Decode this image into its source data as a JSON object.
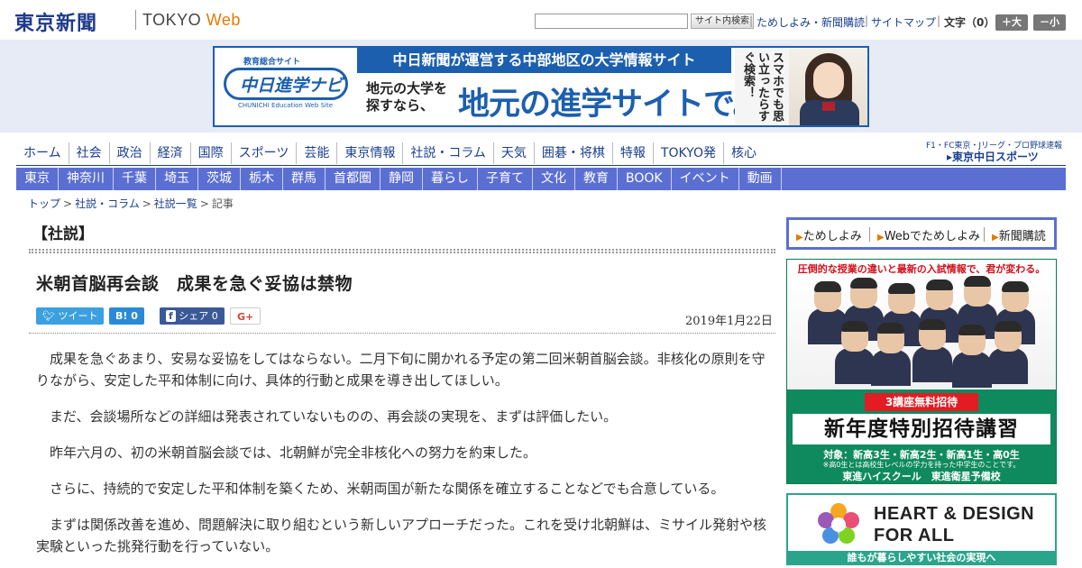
{
  "header": {
    "logo_ja": "東京新聞",
    "logo_en_tokyo": "TOKYO",
    "logo_en_web": "Web",
    "search_button": "サイト内検索",
    "link_trial": "ためしよみ・新聞購読",
    "link_sitemap": "サイトマップ",
    "font_label": "文字（0）",
    "font_plus": "＋大",
    "font_minus": "－小"
  },
  "banner": {
    "logo_top": "教育総合サイト",
    "logo_main": "中日進学ナビ",
    "logo_sub": "CHUNICHI Education Web Site",
    "headline": "中日新聞が運営する中部地区の大学情報サイト",
    "small_text": "地元の大学を探すなら、",
    "big_text": "地元の進学サイトで。",
    "vertical_text": "スマホでも思い立ったらすぐ検索！"
  },
  "nav_primary": [
    "ホーム",
    "社会",
    "政治",
    "経済",
    "国際",
    "スポーツ",
    "芸能",
    "東京情報",
    "社説・コラム",
    "天気",
    "囲碁・将棋",
    "特報",
    "TOKYO発",
    "核心"
  ],
  "nav_secondary": [
    "東京",
    "神奈川",
    "千葉",
    "埼玉",
    "茨城",
    "栃木",
    "群馬",
    "首都圏",
    "静岡",
    "暮らし",
    "子育て",
    "文化",
    "教育",
    "BOOK",
    "イベント",
    "動画"
  ],
  "nav_right": {
    "line1": "F1・FC東京・Jリーグ・プロ野球速報",
    "line2": "東京中日スポーツ"
  },
  "breadcrumb": {
    "items": [
      "トップ",
      "社説・コラム",
      "社説一覧"
    ],
    "current": "記事",
    "separator": ">"
  },
  "article": {
    "section": "【社説】",
    "title": "米朝首脳再会談　成果を急ぐ妥協は禁物",
    "date": "2019年1月22日",
    "share": {
      "tweet": "ツイート",
      "hatena": "B!  0",
      "facebook": "シェア 0",
      "gplus": "G+"
    },
    "paragraphs": [
      "成果を急ぐあまり、安易な妥協をしてはならない。二月下旬に開かれる予定の第二回米朝首脳会談。非核化の原則を守りながら、安定した平和体制に向け、具体的行動と成果を導き出してほしい。",
      "まだ、会談場所などの詳細は発表されていないものの、再会談の実現を、まずは評価したい。",
      "昨年六月の、初の米朝首脳会談では、北朝鮮が完全非核化への努力を約束した。",
      "さらに、持続的で安定した平和体制を築くため、米朝両国が新たな関係を確立することなどでも合意している。",
      "まずは関係改善を進め、問題解決に取り組むという新しいアプローチだった。これを受け北朝鮮は、ミサイル発射や核実験といった挑発行動を行っていない。"
    ]
  },
  "sidebar": {
    "links": [
      "ためしよみ",
      "Webでためしよみ",
      "新聞購読"
    ],
    "ad_toshin": {
      "top": "圧倒的な授業の違いと最新の入試情報で、君が変わる。",
      "badge": "3講座無料招待",
      "big": "新年度特別招待講習",
      "target": "対象：新高3生・新高2生・新高1生・高0生",
      "note": "※高0生とは高校生レベルの学力を持った中学生のことです。",
      "brand": "東進ハイスクール　東進衛星予備校"
    },
    "ad_heart": {
      "line1": "HEART & DESIGN",
      "line2": "FOR ALL",
      "foot": "誰もが暮らしやすい社会の実現へ"
    }
  },
  "colors": {
    "brand_blue": "#1a3f8f",
    "nav_secondary_bg": "#5b6fd3",
    "banner_band_bg": "#e6ebf5",
    "twitter": "#3ba0e0",
    "facebook": "#3b5998"
  }
}
